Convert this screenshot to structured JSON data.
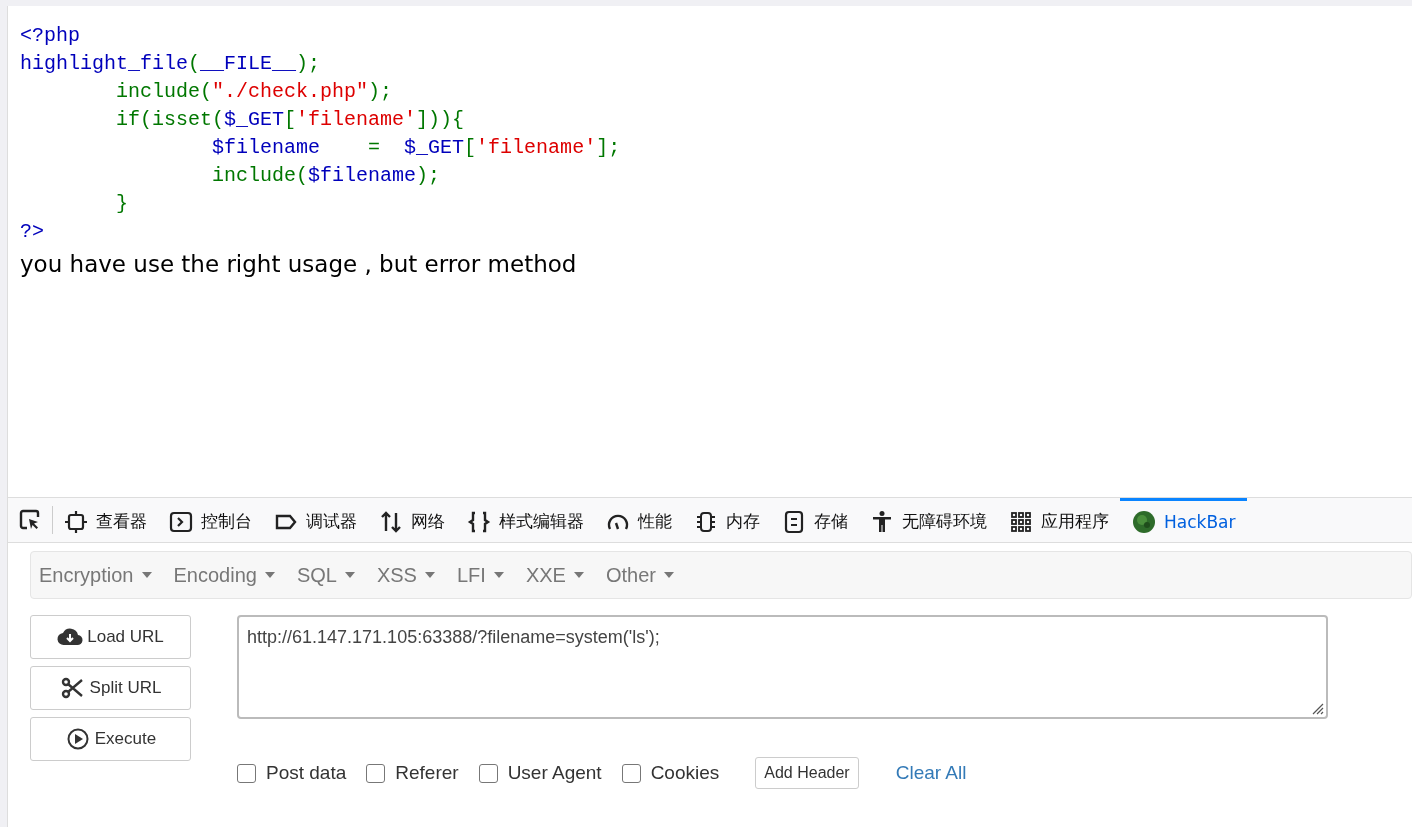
{
  "code_lines": [
    [
      {
        "t": "<?php",
        "kind": "default"
      }
    ],
    [
      {
        "t": "highlight_file",
        "kind": "default"
      },
      {
        "t": "(",
        "kind": "keyword"
      },
      {
        "t": "__FILE__",
        "kind": "default"
      },
      {
        "t": ");",
        "kind": "keyword"
      }
    ],
    [
      {
        "t": "        include(",
        "kind": "keyword"
      },
      {
        "t": "\"./check.php\"",
        "kind": "string"
      },
      {
        "t": ");",
        "kind": "keyword"
      }
    ],
    [
      {
        "t": "        if(isset(",
        "kind": "keyword"
      },
      {
        "t": "$_GET",
        "kind": "default"
      },
      {
        "t": "[",
        "kind": "keyword"
      },
      {
        "t": "'filename'",
        "kind": "string"
      },
      {
        "t": "])){",
        "kind": "keyword"
      }
    ],
    [
      {
        "t": "                $filename",
        "kind": "default"
      },
      {
        "t": "    =  ",
        "kind": "keyword"
      },
      {
        "t": "$_GET",
        "kind": "default"
      },
      {
        "t": "[",
        "kind": "keyword"
      },
      {
        "t": "'filename'",
        "kind": "string"
      },
      {
        "t": "];",
        "kind": "keyword"
      }
    ],
    [
      {
        "t": "                include(",
        "kind": "keyword"
      },
      {
        "t": "$filename",
        "kind": "default"
      },
      {
        "t": ");",
        "kind": "keyword"
      }
    ],
    [
      {
        "t": "        }",
        "kind": "keyword"
      }
    ],
    [
      {
        "t": "?>",
        "kind": "default"
      }
    ]
  ],
  "output_text": "you have use the right usage , but error method",
  "devtools_tabs": [
    {
      "kind": "inspector",
      "label": "查看器",
      "selected": false
    },
    {
      "kind": "console",
      "label": "控制台",
      "selected": false
    },
    {
      "kind": "debugger",
      "label": "调试器",
      "selected": false
    },
    {
      "kind": "network",
      "label": "网络",
      "selected": false
    },
    {
      "kind": "style",
      "label": "样式编辑器",
      "selected": false
    },
    {
      "kind": "performance",
      "label": "性能",
      "selected": false
    },
    {
      "kind": "memory",
      "label": "内存",
      "selected": false
    },
    {
      "kind": "storage",
      "label": "存储",
      "selected": false
    },
    {
      "kind": "accessibility",
      "label": "无障碍环境",
      "selected": false
    },
    {
      "kind": "application",
      "label": "应用程序",
      "selected": false
    },
    {
      "kind": "hackbar",
      "label": "HackBar",
      "selected": true
    }
  ],
  "hackbar": {
    "menus": [
      "Encryption",
      "Encoding",
      "SQL",
      "XSS",
      "LFI",
      "XXE",
      "Other"
    ],
    "actions": [
      {
        "kind": "load",
        "label": "Load URL"
      },
      {
        "kind": "split",
        "label": "Split URL"
      },
      {
        "kind": "execute",
        "label": "Execute"
      }
    ],
    "url": "http://61.147.171.105:63388/?filename=system('ls');",
    "options": [
      {
        "label": "Post data",
        "checked": false
      },
      {
        "label": "Referer",
        "checked": false
      },
      {
        "label": "User Agent",
        "checked": false
      },
      {
        "label": "Cookies",
        "checked": false
      }
    ],
    "add_header": "Add Header",
    "clear_all": "Clear All"
  }
}
